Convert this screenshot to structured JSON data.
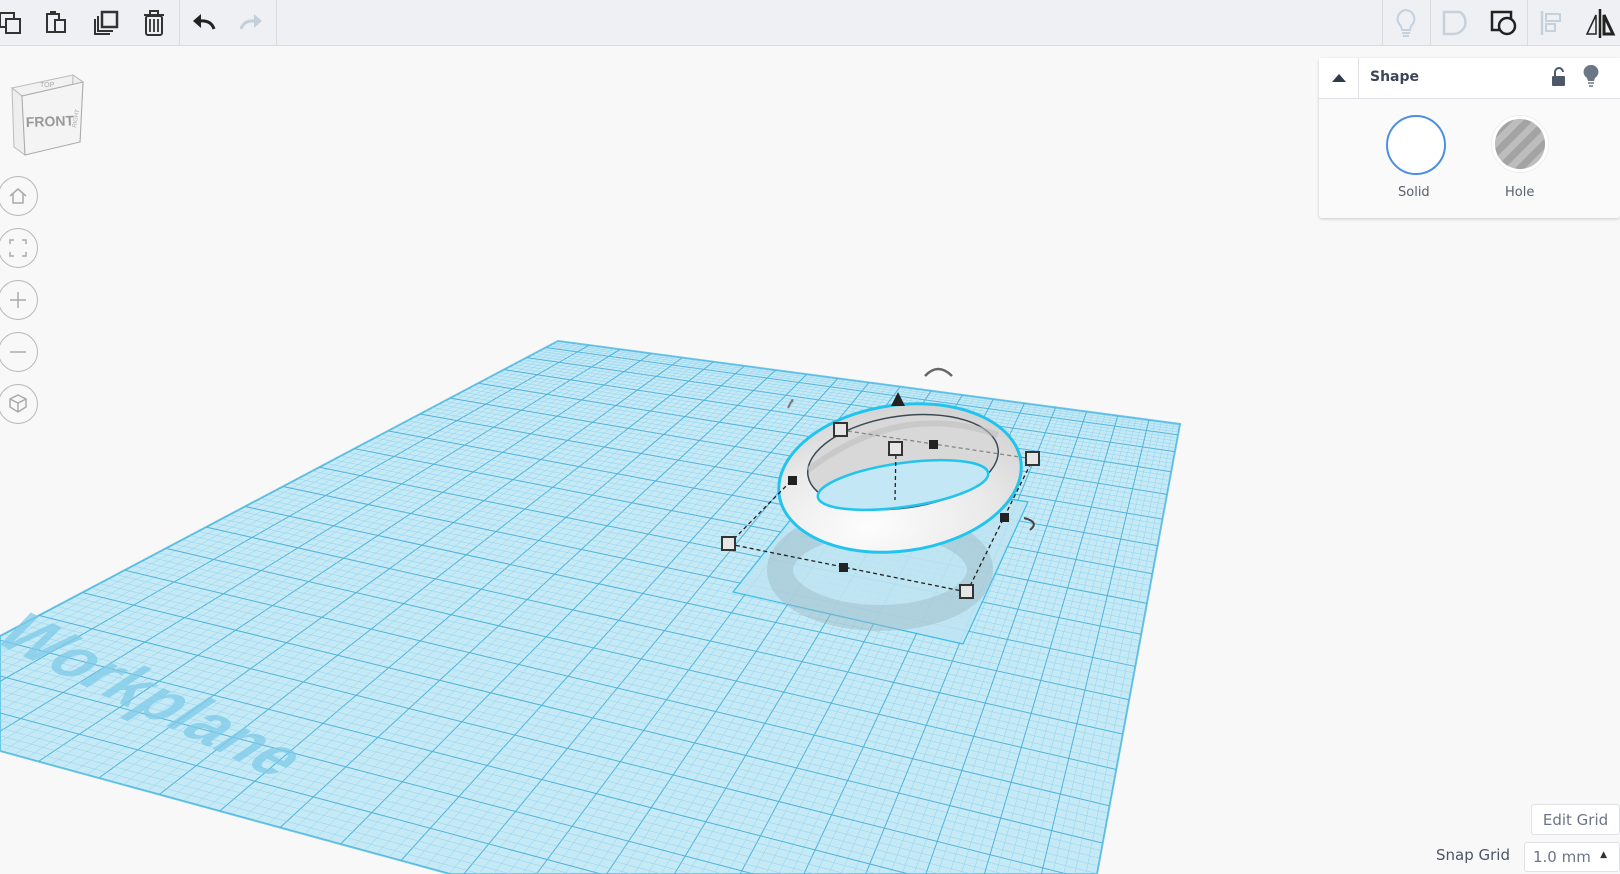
{
  "toolbar": {
    "left_icons": [
      "copy-icon",
      "paste-icon",
      "duplicate-icon",
      "delete-icon",
      "undo-icon",
      "redo-icon"
    ],
    "right_icons": [
      "lightbulb-icon",
      "shape-notes-icon",
      "group-icon",
      "align-icon",
      "mirror-icon"
    ]
  },
  "view_cube": {
    "front": "FRONT",
    "top": "TOP",
    "right": "RIGHT"
  },
  "nav_icons": [
    "home-icon",
    "fit-view-icon",
    "zoom-in-icon",
    "zoom-out-icon",
    "perspective-icon"
  ],
  "workplane": {
    "label": "Workplane",
    "color": "#5fc2e7"
  },
  "shape_panel": {
    "title": "Shape",
    "solid_label": "Solid",
    "hole_label": "Hole",
    "solid_color": "#4a8fe0"
  },
  "grid": {
    "edit_label": "Edit Grid",
    "snap_label": "Snap Grid",
    "snap_value": "1.0 mm"
  }
}
